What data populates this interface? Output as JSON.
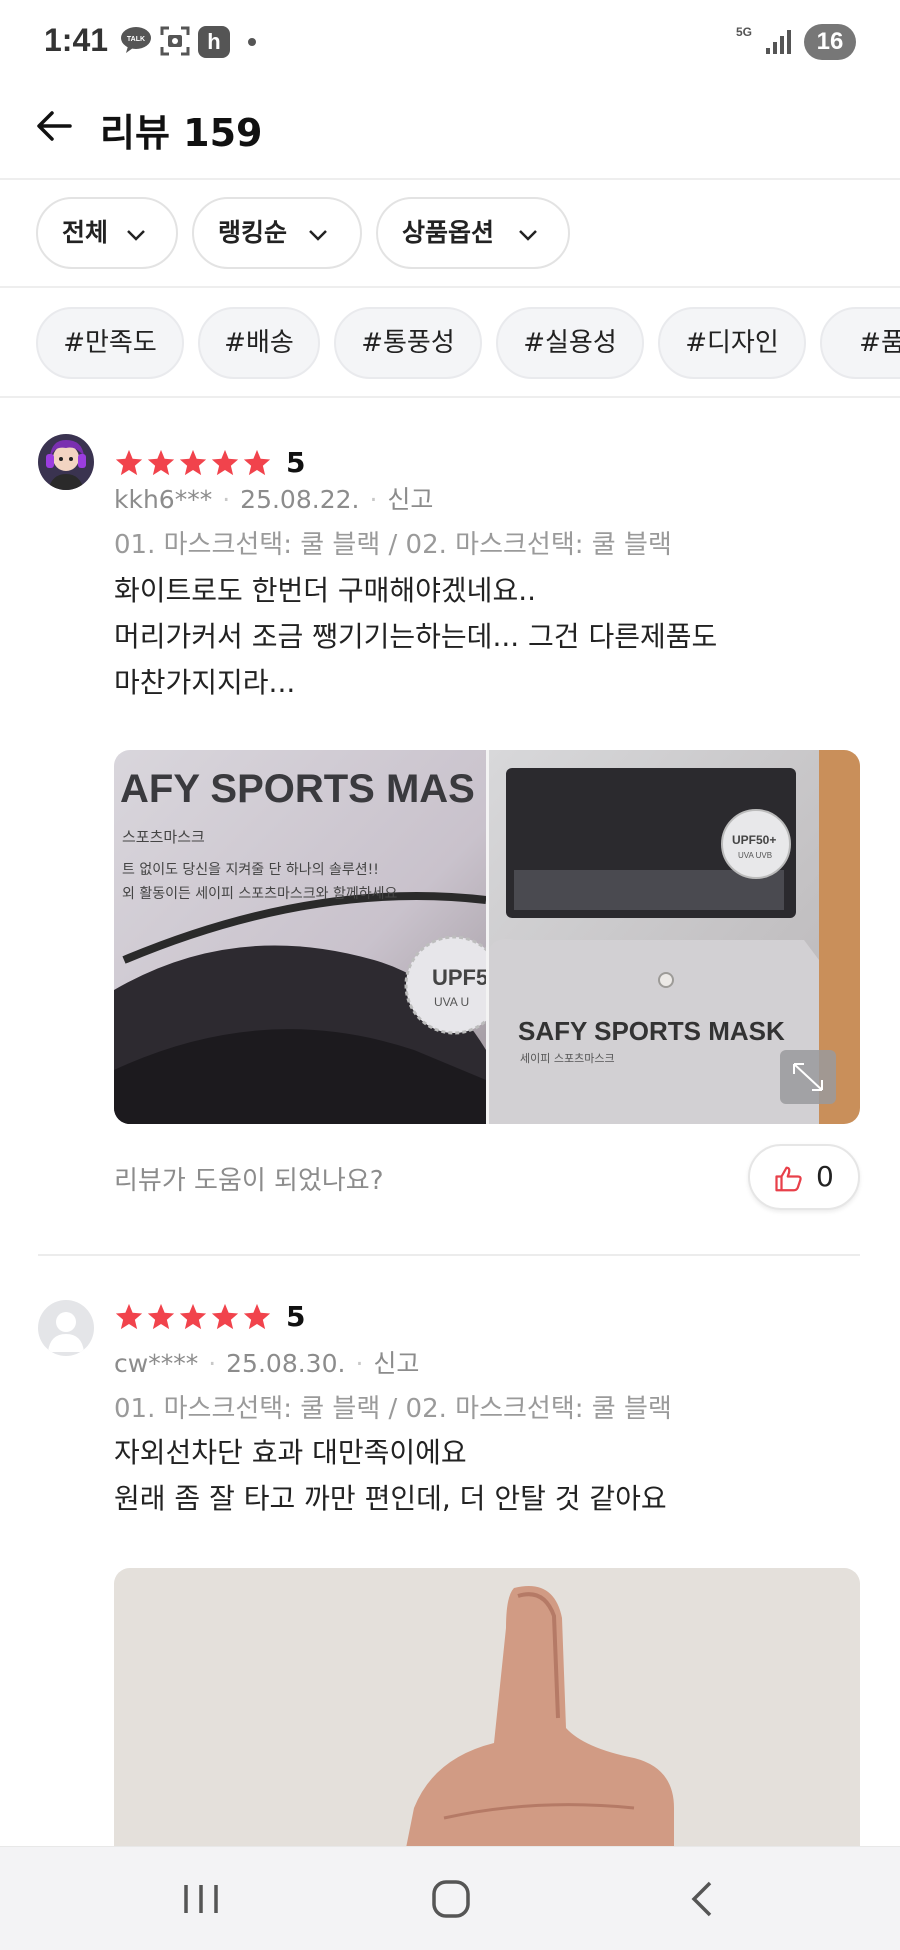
{
  "status_bar": {
    "time": "1:41",
    "notification_icons": [
      "kakaotalk-icon",
      "screenshot-icon",
      "h-app-icon",
      "dot-icon"
    ],
    "h_icon_letter": "h",
    "talk_icon_label": "TALK",
    "network": "5G",
    "battery": "16"
  },
  "header": {
    "title": "리뷰 159"
  },
  "filters": [
    {
      "label": "전체"
    },
    {
      "label": "랭킹순"
    },
    {
      "label": "상품옵션"
    }
  ],
  "tags": [
    "#만족도",
    "#배송",
    "#통풍성",
    "#실용성",
    "#디자인",
    "#품질"
  ],
  "reviews": [
    {
      "rating": "5",
      "stars": 5,
      "user": "kkh6***",
      "date": "25.08.22.",
      "report": "신고",
      "option": "01. 마스크선택: 쿨 블랙 / 02. 마스크선택: 쿨 블랙",
      "text": "화이트로도 한번더 구매해야겠네요..\n머리가커서 조금 쨍기기는하는데... 그건 다른제품도\n마찬가지지라...",
      "photo_text_1": "AFY SPORTS MAS",
      "photo_text_1_sub": "스포츠마스크",
      "photo_text_1_line1": "트 없이도 당신을 지켜줄 단 하나의 솔루션!!",
      "photo_text_1_line2": "외 활동이든 세이피 스포츠마스크와 함께하세요",
      "photo_badge_1": "UPF5",
      "photo_badge_1_sub": "UVA U",
      "photo_text_2": "SAFY SPORTS MASK",
      "photo_text_2_sub": "세이피 스포츠마스크",
      "photo_badge_2": "UPF50+",
      "photo_badge_2_sub": "UVA UVB",
      "helpful_question": "리뷰가 도움이 되었나요?",
      "likes": "0"
    },
    {
      "rating": "5",
      "stars": 5,
      "user": "cw****",
      "date": "25.08.30.",
      "report": "신고",
      "option": "01. 마스크선택: 쿨 블랙 / 02. 마스크선택: 쿨 블랙",
      "text": "자외선차단 효과 대만족이에요\n원래 좀 잘 타고 까만 편인데, 더 안탈 것 같아요"
    }
  ],
  "colors": {
    "star": "#f1434c",
    "like_icon": "#e8404a",
    "chip_border": "#e3e3e3",
    "tag_bg": "#f4f5f7"
  }
}
